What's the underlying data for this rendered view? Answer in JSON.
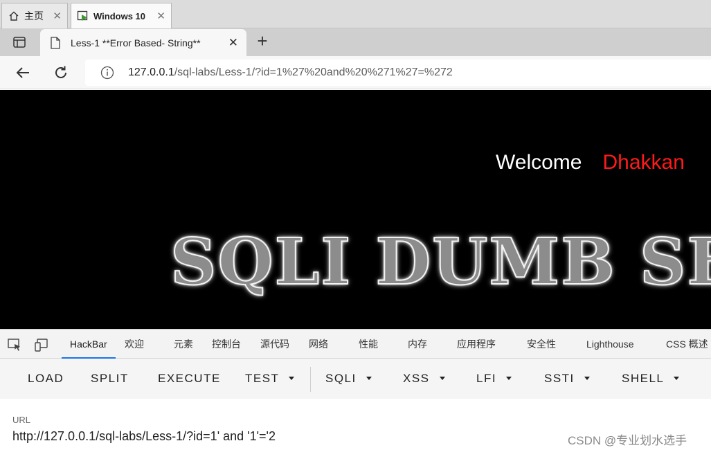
{
  "vm_tabs": [
    {
      "label": "主页"
    },
    {
      "label": "Windows 10"
    }
  ],
  "browser": {
    "tab_title": "Less-1 **Error Based- String**",
    "address": {
      "host": "127.0.0.1",
      "path": "/sql-labs/Less-1/?id=1%27%20and%20%271%27=%272"
    }
  },
  "page": {
    "welcome": "Welcome",
    "user_name": "Dhakkan",
    "banner_text": "SQLI DUMB SERIES"
  },
  "devtools": {
    "tabs": [
      "HackBar",
      "欢迎",
      "元素",
      "控制台",
      "源代码",
      "网络",
      "性能",
      "内存",
      "应用程序",
      "安全性",
      "Lighthouse",
      "CSS 概述"
    ],
    "active_tab": "HackBar"
  },
  "hackbar": {
    "buttons": [
      {
        "label": "LOAD"
      },
      {
        "label": "SPLIT"
      },
      {
        "label": "EXECUTE"
      },
      {
        "label": "TEST"
      },
      {
        "label": "SQLI"
      },
      {
        "label": "XSS"
      },
      {
        "label": "LFI"
      },
      {
        "label": "SSTI"
      },
      {
        "label": "SHELL"
      }
    ],
    "url_label": "URL",
    "url_value": "http://127.0.0.1/sql-labs/Less-1/?id=1' and '1'='2"
  },
  "watermark": "CSDN @专业划水选手",
  "colors": {
    "accent": "#1a73e8",
    "user_name": "#ff1a1a",
    "page_bg": "#000000"
  }
}
